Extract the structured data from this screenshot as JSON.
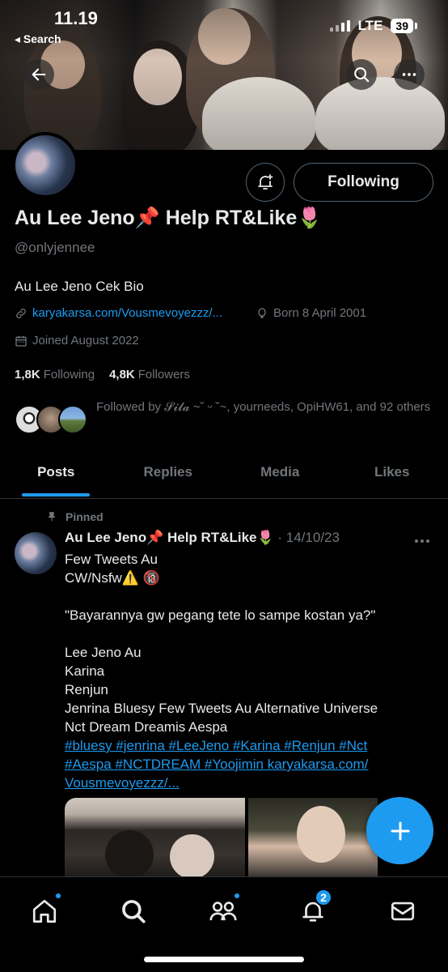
{
  "status": {
    "time": "11.19",
    "back_label": "◂ Search",
    "network": "LTE",
    "battery": "39"
  },
  "profile": {
    "name": "Au Lee Jeno📌 Help RT&Like🌷",
    "handle": "@onlyjennee",
    "bio": "Au Lee Jeno Cek Bio",
    "link": "karyakarsa.com/Vousmevoyezzz/...",
    "born": "Born 8 April 2001",
    "joined": "Joined August 2022",
    "following_count": "1,8K",
    "following_label": "Following",
    "followers_count": "4,8K",
    "followers_label": "Followers",
    "followed_by": "Followed by 𝓢𝓲𝓵𝓪 ~˘ ᵕ ˘~, yourneeds, OpiHW61, and 92 others",
    "follow_button": "Following"
  },
  "tabs": [
    {
      "label": "Posts",
      "active": true
    },
    {
      "label": "Replies",
      "active": false
    },
    {
      "label": "Media",
      "active": false
    },
    {
      "label": "Likes",
      "active": false
    }
  ],
  "tweet": {
    "pinned_label": "Pinned",
    "author": "Au Lee Jeno📌 Help RT&Like🌷",
    "date": "· 14/10/23",
    "lines": [
      "Few Tweets Au",
      "CW/Nsfw⚠️ 🔞",
      "",
      "\"Bayarannya gw pegang tete lo sampe kostan ya?\"",
      "",
      "Lee Jeno Au",
      "Karina",
      "Renjun",
      "Jenrina Bluesy Few Tweets Au Alternative Universe",
      "Nct Dream Dreamis Aespa"
    ],
    "hashtags_line1": "#bluesy #jenrina #LeeJeno #Karina #Renjun #Nct",
    "hashtags_line2": "#Aespa #NCTDREAM #Yoojimin  karyakarsa.com/",
    "hashtags_line3": "Vousmevoyezzz/..."
  },
  "nav": {
    "notifications_badge": "2"
  },
  "colors": {
    "accent": "#1d9bf0",
    "muted": "#71767b",
    "text": "#e7e9ea",
    "border": "#536471"
  },
  "icons": [
    "back-arrow-icon",
    "search-icon",
    "more-icon",
    "notification-bell-add-icon",
    "link-icon",
    "birthday-balloon-icon",
    "calendar-icon",
    "pin-icon",
    "plus-icon",
    "home-icon",
    "communities-icon",
    "bell-icon",
    "mail-icon"
  ]
}
